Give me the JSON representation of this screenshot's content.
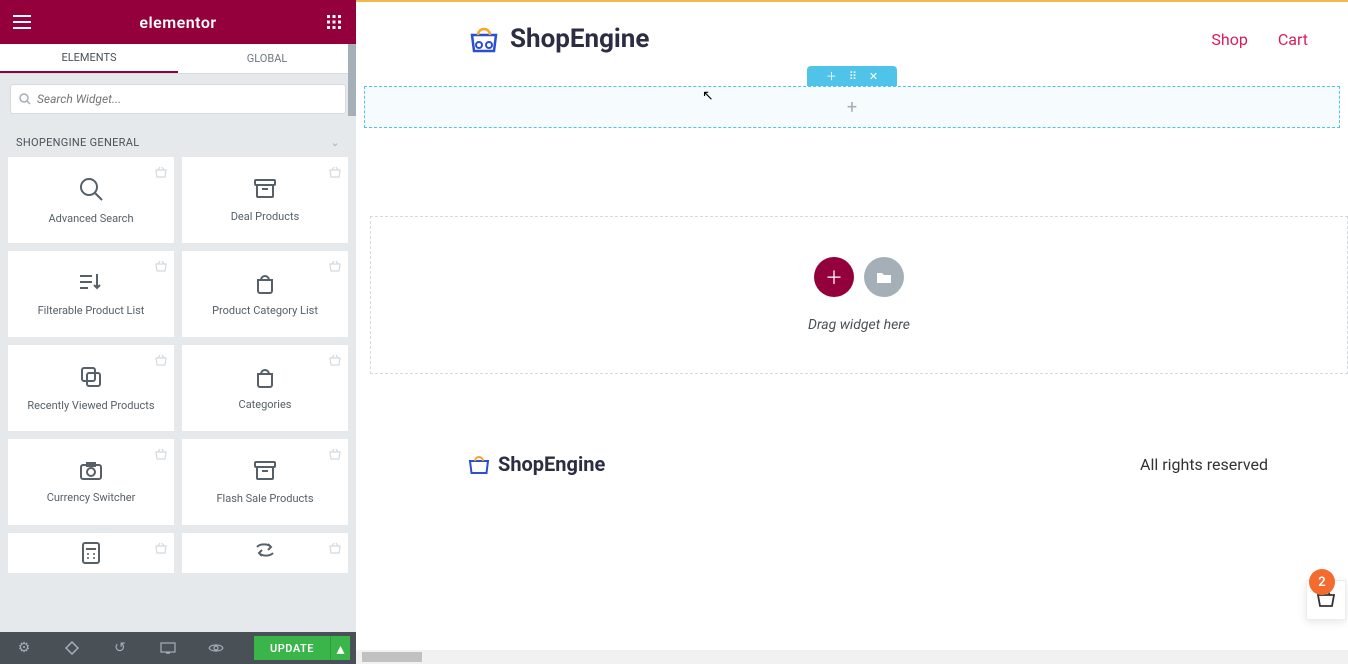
{
  "sidebar": {
    "brand": "elementor",
    "tabs": {
      "elements": "ELEMENTS",
      "global": "GLOBAL"
    },
    "search_placeholder": "Search Widget...",
    "section_title": "SHOPENGINE GENERAL",
    "widgets": [
      {
        "label": "Advanced Search"
      },
      {
        "label": "Deal Products"
      },
      {
        "label": "Filterable Product List"
      },
      {
        "label": "Product Category List"
      },
      {
        "label": "Recently Viewed Products"
      },
      {
        "label": "Categories"
      },
      {
        "label": "Currency Switcher"
      },
      {
        "label": "Flash Sale Products"
      }
    ],
    "update_label": "UPDATE"
  },
  "canvas": {
    "brand": "ShopEngine",
    "nav": {
      "shop": "Shop",
      "cart": "Cart"
    },
    "section_plus": "+",
    "drop_hint": "Drag widget here",
    "footer_brand": "ShopEngine",
    "footer_right": "All rights reserved",
    "cart_count": "2"
  }
}
